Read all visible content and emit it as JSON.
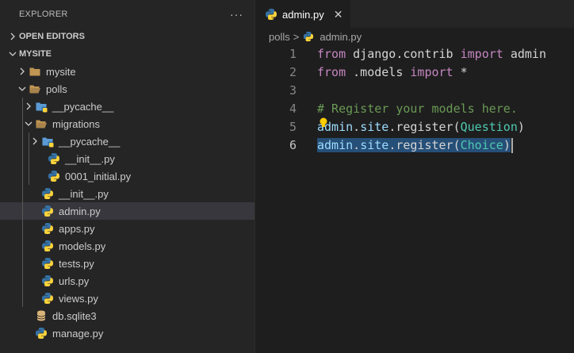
{
  "sidebar": {
    "title": "EXPLORER",
    "more_label": "···",
    "open_editors_label": "OPEN EDITORS",
    "workspace_label": "MYSITE",
    "items": [
      {
        "label": "mysite",
        "icon": "folder-icon",
        "depth": 1,
        "chevron": "right"
      },
      {
        "label": "polls",
        "icon": "folder-open-icon",
        "depth": 1,
        "chevron": "down"
      },
      {
        "label": "__pycache__",
        "icon": "folder-pycache-icon",
        "depth": 2,
        "chevron": "right"
      },
      {
        "label": "migrations",
        "icon": "folder-open-icon",
        "depth": 2,
        "chevron": "down"
      },
      {
        "label": "__pycache__",
        "icon": "folder-pycache-icon",
        "depth": 3,
        "chevron": "right"
      },
      {
        "label": "__init__.py",
        "icon": "python-icon",
        "depth": 3,
        "chevron": "none"
      },
      {
        "label": "0001_initial.py",
        "icon": "python-icon",
        "depth": 3,
        "chevron": "none"
      },
      {
        "label": "__init__.py",
        "icon": "python-icon",
        "depth": 2,
        "chevron": "none"
      },
      {
        "label": "admin.py",
        "icon": "python-icon",
        "depth": 2,
        "chevron": "none",
        "selected": true
      },
      {
        "label": "apps.py",
        "icon": "python-icon",
        "depth": 2,
        "chevron": "none"
      },
      {
        "label": "models.py",
        "icon": "python-icon",
        "depth": 2,
        "chevron": "none"
      },
      {
        "label": "tests.py",
        "icon": "python-icon",
        "depth": 2,
        "chevron": "none"
      },
      {
        "label": "urls.py",
        "icon": "python-icon",
        "depth": 2,
        "chevron": "none"
      },
      {
        "label": "views.py",
        "icon": "python-icon",
        "depth": 2,
        "chevron": "none"
      },
      {
        "label": "db.sqlite3",
        "icon": "database-icon",
        "depth": 1,
        "chevron": "none"
      },
      {
        "label": "manage.py",
        "icon": "python-icon",
        "depth": 1,
        "chevron": "none"
      }
    ]
  },
  "editor": {
    "tab_label": "admin.py",
    "tab_close": "✕",
    "breadcrumb_folder": "polls",
    "breadcrumb_sep": ">",
    "breadcrumb_file": "admin.py",
    "lines": [
      {
        "num": "1",
        "tokens": [
          {
            "t": "from",
            "c": "kw"
          },
          {
            "t": " django.contrib ",
            "c": "plain"
          },
          {
            "t": "import",
            "c": "kw"
          },
          {
            "t": " admin",
            "c": "plain"
          }
        ]
      },
      {
        "num": "2",
        "tokens": [
          {
            "t": "from",
            "c": "kw"
          },
          {
            "t": " .models ",
            "c": "plain"
          },
          {
            "t": "import",
            "c": "kw"
          },
          {
            "t": " *",
            "c": "plain"
          }
        ]
      },
      {
        "num": "3",
        "tokens": []
      },
      {
        "num": "4",
        "tokens": [
          {
            "t": "# Register your models here.",
            "c": "cmt"
          }
        ]
      },
      {
        "num": "5",
        "tokens": [
          {
            "t": "admin",
            "c": "id"
          },
          {
            "t": ".",
            "c": "plain"
          },
          {
            "t": "site",
            "c": "id"
          },
          {
            "t": ".register(",
            "c": "plain"
          },
          {
            "t": "Question",
            "c": "cls"
          },
          {
            "t": ")",
            "c": "plain"
          }
        ]
      },
      {
        "num": "6",
        "active": true,
        "selected": true,
        "tokens": [
          {
            "t": "admin",
            "c": "id"
          },
          {
            "t": ".",
            "c": "plain"
          },
          {
            "t": "site",
            "c": "id"
          },
          {
            "t": ".register(",
            "c": "plain"
          },
          {
            "t": "Choice",
            "c": "cls"
          },
          {
            "t": ")",
            "c": "plain"
          }
        ]
      }
    ]
  },
  "colors": {
    "python_blue": "#3572a5",
    "python_yellow": "#ffd43b",
    "folder": "#c09553",
    "pycache_folder": "#5b9bd5",
    "database": "#dcb67a",
    "lightbulb": "#ffcc00"
  }
}
